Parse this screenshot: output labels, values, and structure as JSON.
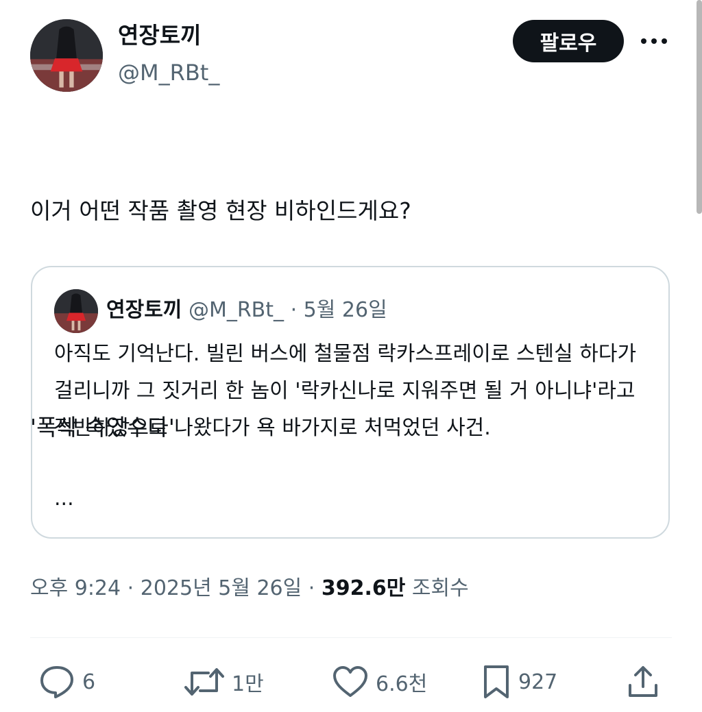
{
  "author": {
    "display_name": "연장토끼",
    "handle": "@M_RBt_"
  },
  "buttons": {
    "follow_label": "팔로우",
    "more_icon": "more-horizontal-icon"
  },
  "tweet": {
    "lines": [
      "이거 어떤 작품 촬영 현장 비하인드게요?",
      "'폭삭 속았수다'"
    ]
  },
  "quote": {
    "display_name": "연장토끼",
    "handle": "@M_RBt_",
    "separator": "·",
    "date": "5월 26일",
    "text": "아직도 기억난다. 빌린 버스에 철물점 락카스프레이로 스텐실 하다가 걸리니까 그 짓거리 한 놈이 '락카신나로 지워주면 될 거 아니냐'라고 적반하장으로 나왔다가 욕 바가지로 처먹었던 사건.",
    "ellipsis": "..."
  },
  "meta": {
    "time": "오후 9:24",
    "separator": "·",
    "date": "2025년 5월 26일",
    "views_count": "392.6만",
    "views_label": "조회수"
  },
  "actions": {
    "reply": {
      "icon": "reply-icon",
      "count": "6"
    },
    "retweet": {
      "icon": "retweet-icon",
      "count": "1만"
    },
    "like": {
      "icon": "heart-icon",
      "count": "6.6천"
    },
    "bookmark": {
      "icon": "bookmark-icon",
      "count": "927"
    },
    "share": {
      "icon": "share-icon"
    }
  },
  "colors": {
    "text_primary": "#0f1419",
    "text_secondary": "#536471",
    "border": "#cfd9de",
    "follow_bg": "#0f1419"
  }
}
